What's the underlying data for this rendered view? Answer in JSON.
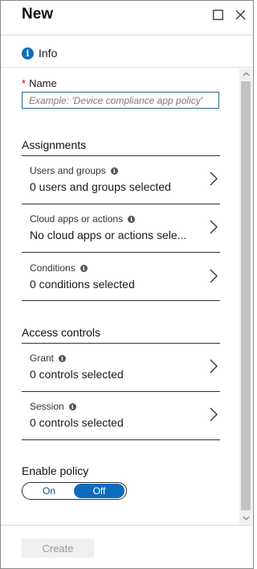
{
  "header": {
    "title": "New",
    "maximize_icon": "maximize-icon",
    "close_icon": "close-icon"
  },
  "info_link": {
    "label": "Info",
    "icon": "info-icon"
  },
  "name_field": {
    "label": "Name",
    "required_marker": "*",
    "placeholder": "Example: 'Device compliance app policy'",
    "value": ""
  },
  "assignments": {
    "title": "Assignments",
    "rows": [
      {
        "label": "Users and groups",
        "value": "0 users and groups selected"
      },
      {
        "label": "Cloud apps or actions",
        "value": "No cloud apps or actions sele..."
      },
      {
        "label": "Conditions",
        "value": "0 conditions selected"
      }
    ]
  },
  "access_controls": {
    "title": "Access controls",
    "rows": [
      {
        "label": "Grant",
        "value": "0 controls selected"
      },
      {
        "label": "Session",
        "value": "0 controls selected"
      }
    ]
  },
  "enable_policy": {
    "label": "Enable policy",
    "options": [
      "On",
      "Off"
    ],
    "selected": "Off"
  },
  "footer": {
    "create_label": "Create",
    "create_enabled": false
  },
  "colors": {
    "accent": "#0f6cbd",
    "required": "#cc0000",
    "disabled_text": "#9a9a9a"
  }
}
